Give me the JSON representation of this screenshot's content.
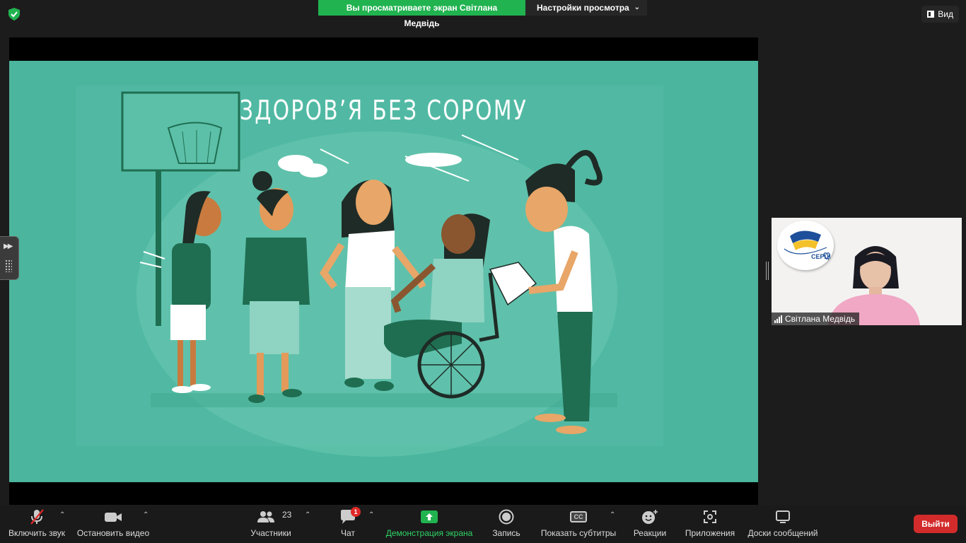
{
  "topbar": {
    "share_banner": "Вы просматриваете экран Світлана Медвідь",
    "view_settings": "Настройки просмотра",
    "view_button": "Вид"
  },
  "slide": {
    "title": "ЗДОРОВ’Я БЕЗ СОРОМУ"
  },
  "video": {
    "participant_name": "Світлана Медвідь",
    "logo_text": "СЕРЦІ"
  },
  "toolbar": {
    "unmute": "Включить звук",
    "stop_video": "Остановить видео",
    "participants": "Участники",
    "participants_count": "23",
    "chat": "Чат",
    "chat_badge": "1",
    "share_screen": "Демонстрация экрана",
    "record": "Запись",
    "captions": "Показать субтитры",
    "captions_icon": "CC",
    "reactions": "Реакции",
    "apps": "Приложения",
    "whiteboards": "Доски сообщений",
    "leave": "Выйти"
  },
  "colors": {
    "slide_bg": "#4bb59d",
    "share_green": "#21b350",
    "leave_red": "#d32b2b",
    "dark_green": "#1f6e52"
  },
  "icons": [
    "shield-icon",
    "grid-icon",
    "mic-off-icon",
    "video-camera-icon",
    "participants-icon",
    "chat-icon",
    "share-screen-icon",
    "record-icon",
    "cc-icon",
    "reactions-icon",
    "apps-icon",
    "whiteboard-icon"
  ]
}
